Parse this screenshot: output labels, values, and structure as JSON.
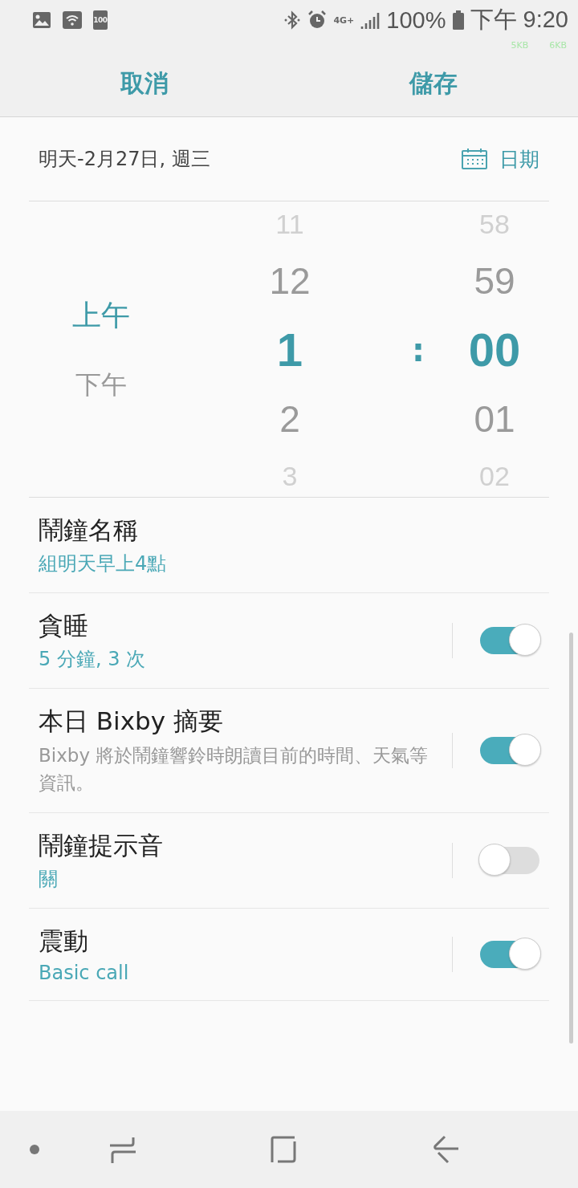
{
  "status_bar": {
    "battery_badge": "100",
    "network": "4G+",
    "battery": "100%",
    "time": "下午 9:20",
    "speeds": [
      "5KB",
      "6KB"
    ]
  },
  "header": {
    "cancel": "取消",
    "save": "儲存"
  },
  "date_row": {
    "text": "明天-2月27日, 週三",
    "button": "日期"
  },
  "picker": {
    "ampm": [
      {
        "label": "上午",
        "selected": true
      },
      {
        "label": "下午",
        "selected": false
      }
    ],
    "hours": [
      {
        "label": "11",
        "selected": false
      },
      {
        "label": "12",
        "selected": false
      },
      {
        "label": "1",
        "selected": true
      },
      {
        "label": "2",
        "selected": false
      },
      {
        "label": "3",
        "selected": false
      }
    ],
    "separator": ":",
    "minutes": [
      {
        "label": "58",
        "selected": false
      },
      {
        "label": "59",
        "selected": false
      },
      {
        "label": "00",
        "selected": true
      },
      {
        "label": "01",
        "selected": false
      },
      {
        "label": "02",
        "selected": false
      }
    ]
  },
  "settings": [
    {
      "kind": "text",
      "title": "鬧鐘名稱",
      "summary": "組明天早上4點"
    },
    {
      "kind": "toggle",
      "title": "貪睡",
      "summary": "5 分鐘, 3 次",
      "on": true
    },
    {
      "kind": "toggle",
      "title": "本日 Bixby 摘要",
      "description": "Bixby 將於鬧鐘響鈴時朗讀目前的時間、天氣等資訊。",
      "on": true
    },
    {
      "kind": "toggle",
      "title": "鬧鐘提示音",
      "summary": "關",
      "on": false
    },
    {
      "kind": "toggle",
      "title": "震動",
      "summary": "Basic call",
      "on": true
    }
  ]
}
